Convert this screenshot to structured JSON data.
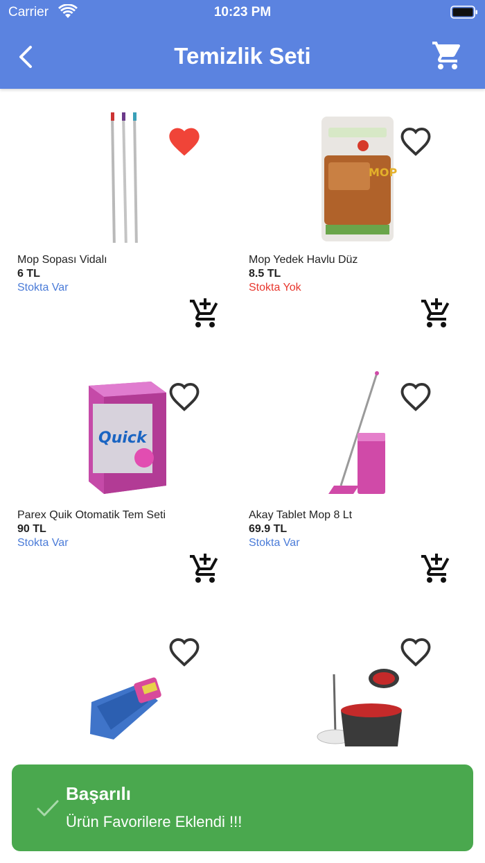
{
  "status_bar": {
    "carrier": "Carrier",
    "time": "10:23 PM"
  },
  "nav": {
    "title": "Temizlik Seti",
    "back_icon": "chevron-left-icon",
    "cart_icon": "cart-icon"
  },
  "products": [
    {
      "name": "Mop Sopası Vidalı",
      "price": "6 TL",
      "stock": "Stokta Var",
      "in_stock": true,
      "favorite": true
    },
    {
      "name": "Mop Yedek Havlu Düz",
      "price": "8.5 TL",
      "stock": "Stokta Yok",
      "in_stock": false,
      "favorite": false
    },
    {
      "name": "Parex Quik Otomatik Tem Seti",
      "price": "90 TL",
      "stock": "Stokta Var",
      "in_stock": true,
      "favorite": false
    },
    {
      "name": "Akay Tablet Mop 8 Lt",
      "price": "69.9 TL",
      "stock": "Stokta Var",
      "in_stock": true,
      "favorite": false
    },
    {
      "name": "",
      "price": "",
      "stock": "",
      "favorite": false
    },
    {
      "name": "",
      "price": "",
      "stock": "",
      "favorite": false
    }
  ],
  "toast": {
    "title": "Başarılı",
    "message": "Ürün Favorilere Eklendi !!!"
  },
  "colors": {
    "header": "#5b83e0",
    "in_stock": "#4a7bd8",
    "out_of_stock": "#e8372e",
    "favorite_active": "#f04438",
    "toast": "#4aa84e"
  }
}
